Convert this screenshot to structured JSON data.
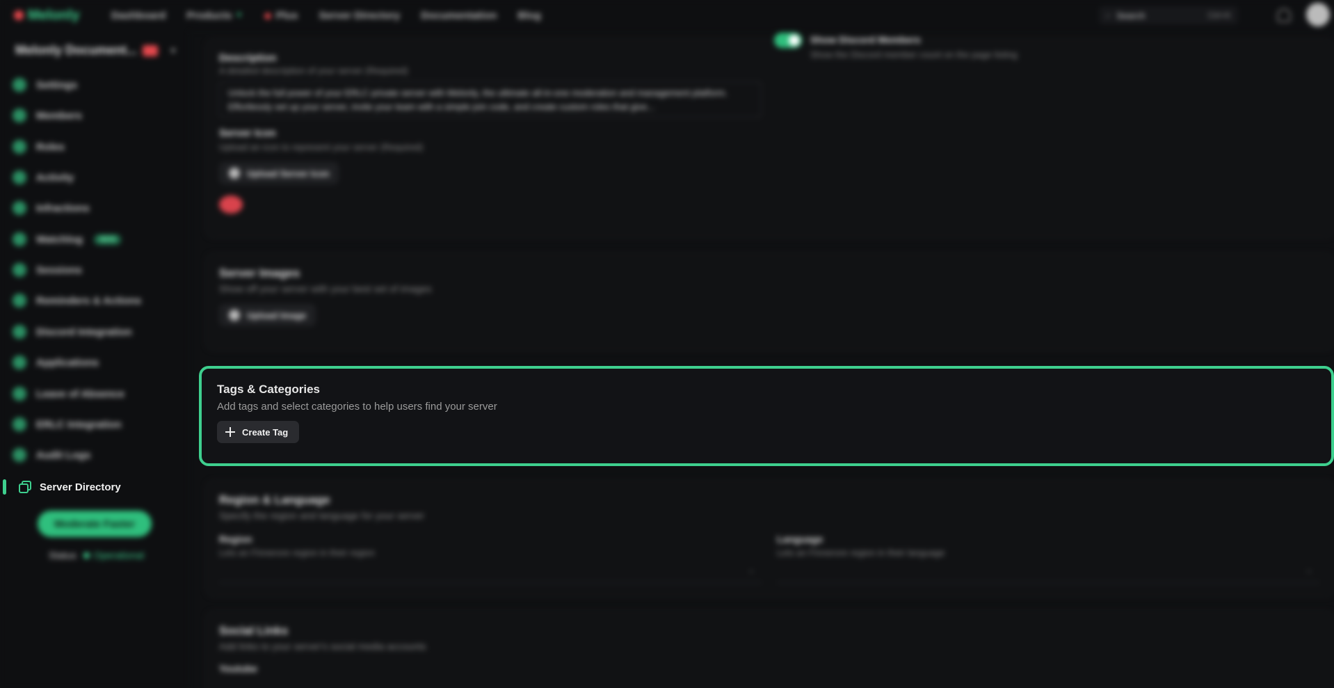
{
  "topnav": {
    "brand": "Melonly",
    "items": [
      "Dashboard",
      "Products",
      "Plus",
      "Server Directory",
      "Documentation",
      "Blog"
    ],
    "search_label": "Search",
    "search_kbd": "Ctrl+K"
  },
  "sidebar": {
    "workspace_name": "Melonly Document...",
    "items": [
      {
        "label": "Settings"
      },
      {
        "label": "Members"
      },
      {
        "label": "Roles"
      },
      {
        "label": "Activity"
      },
      {
        "label": "Infractions"
      },
      {
        "label": "Watchlog",
        "badge": "NEW"
      },
      {
        "label": "Sessions"
      },
      {
        "label": "Reminders & Actions"
      },
      {
        "label": "Discord Integration"
      },
      {
        "label": "Applications"
      },
      {
        "label": "Leave of Absence"
      },
      {
        "label": "ERLC Integration"
      },
      {
        "label": "Audit Logs"
      }
    ],
    "active_item": "Server Directory",
    "upgrade_label": "Moderate Faster",
    "status_label": "Status",
    "status_value": "Operational"
  },
  "main": {
    "description": {
      "title": "Description",
      "subtitle": "A detailed description of your server (Required)",
      "text": "Unlock the full power of your ERLC private server with Melonly, the ultimate all-in-one moderation and management platform. Effortlessly set up your server, invite your team with a simple join code, and create custom roles that give..."
    },
    "show_members": {
      "title": "Show Discord Members",
      "subtitle": "Show the Discord member count on the page listing"
    },
    "server_icon": {
      "title": "Server Icon",
      "subtitle": "Upload an icon to represent your server (Required)",
      "button": "Upload Server Icon"
    },
    "server_images": {
      "title": "Server Images",
      "subtitle": "Show off your server with your best set of images",
      "button": "Upload Image"
    },
    "tags": {
      "title": "Tags & Categories",
      "subtitle": "Add tags and select categories to help users find your server",
      "button": "Create Tag"
    },
    "region_language": {
      "title": "Region & Language",
      "subtitle": "Specify the region and language for your server",
      "region_label": "Region",
      "region_help": "Lets an Finnerore region in their region",
      "language_label": "Language",
      "language_help": "Lets an Finnerore region in their language"
    },
    "social_links": {
      "title": "Social Links",
      "subtitle": "Add links to your server's social media accounts",
      "first_label": "Youtube"
    }
  }
}
